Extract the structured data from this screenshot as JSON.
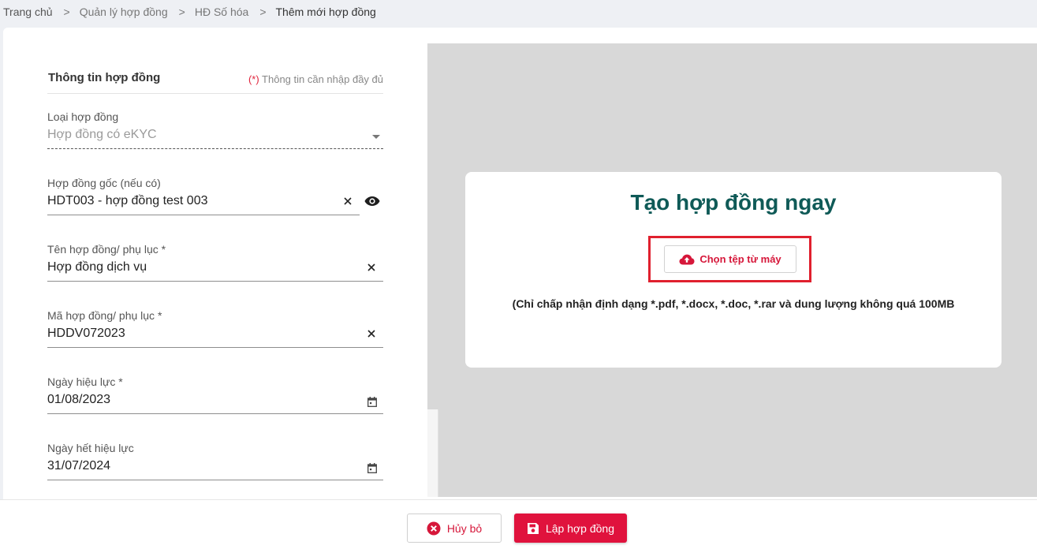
{
  "breadcrumb": {
    "items": [
      "Trang chủ",
      "Quản lý hợp đồng",
      "HĐ Số hóa",
      "Thêm mới hợp đồng"
    ],
    "separator": ">"
  },
  "section": {
    "title": "Thông tin hợp đồng",
    "required_mark": "(*)",
    "required_note": "Thông tin cần nhập đầy đủ"
  },
  "fields": {
    "contract_type": {
      "label": "Loại hợp đồng",
      "value": "Hợp đồng có eKYC"
    },
    "original_contract": {
      "label": "Hợp đồng gốc (nếu có)",
      "value": "HDT003 - hợp đồng test 003"
    },
    "contract_name": {
      "label": "Tên hợp đồng/ phụ lục *",
      "value": "Hợp đồng dịch vụ"
    },
    "contract_code": {
      "label": "Mã hợp đồng/ phụ lục *",
      "value": "HDDV072023"
    },
    "effective_date": {
      "label": "Ngày hiệu lực *",
      "value": "01/08/2023"
    },
    "expiry_date": {
      "label": "Ngày hết hiệu lực",
      "value": "31/07/2024"
    }
  },
  "upload": {
    "title": "Tạo hợp đồng ngay",
    "button_label": "Chọn tệp từ máy",
    "hint": "(Chỉ chấp nhận định dạng *.pdf, *.docx, *.doc, *.rar và dung lượng không quá 100MB"
  },
  "footer": {
    "cancel_label": "Hủy bỏ",
    "submit_label": "Lập hợp đồng"
  },
  "colors": {
    "accent": "#e0123d",
    "title_teal": "#0f5a57",
    "highlight_border": "#e0202e"
  },
  "icons": [
    "close-icon",
    "eye-icon",
    "calendar-icon",
    "cloud-upload-icon",
    "cancel-circle-icon",
    "save-icon",
    "dropdown-arrow-icon"
  ]
}
